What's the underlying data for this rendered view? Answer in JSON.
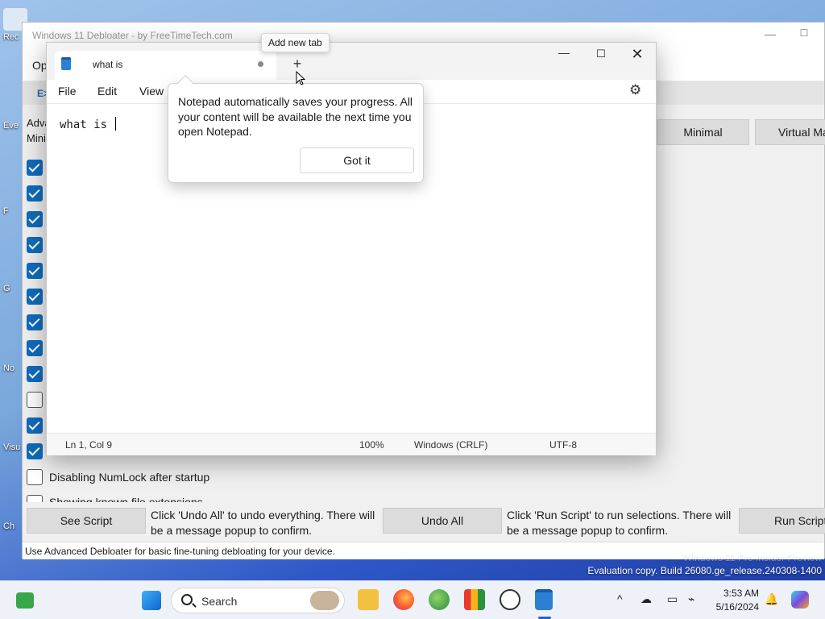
{
  "desktop": {
    "icons": [
      "Rec",
      "Eve",
      "F",
      "G",
      "No",
      "Visu",
      "Ch"
    ]
  },
  "debloater": {
    "title": "Windows 11 Debloater - by FreeTimeTech.com",
    "menu_options": "Op",
    "tab_e": "E>",
    "adv_label": "Adva",
    "mini_label": "Mini",
    "preset_minimal": "Minimal",
    "preset_virtual": "Virtual Ma",
    "checkbox_numlock": "Disabling NumLock after startup",
    "checkbox_known_ext": "Showing known file extensions",
    "see_script": "See Script",
    "undo_note": "Click 'Undo All' to undo everything. There will be a message popup to confirm.",
    "undo_all": "Undo All",
    "run_note": "Click 'Run Script' to run selections. There will be a message popup to confirm.",
    "run_script": "Run Script",
    "status": "Use Advanced Debloater for basic fine-tuning debloating for your device."
  },
  "notepad": {
    "tab_title": "what is",
    "tooltip": "Add new tab",
    "menu": {
      "file": "File",
      "edit": "Edit",
      "view": "View"
    },
    "content": "what is ",
    "tip_text": "Notepad automatically saves your progress. All your content will be available the next time you open Notepad.",
    "tip_button": "Got it",
    "status": {
      "position": "Ln 1, Col 9",
      "zoom": "100%",
      "eol": "Windows (CRLF)",
      "encoding": "UTF-8"
    }
  },
  "watermark": {
    "line1": "Windows 11 Pro Insider Preview",
    "line2": "Evaluation copy. Build 26080.ge_release.240308-1400"
  },
  "taskbar": {
    "search": "Search",
    "time": "3:53 AM",
    "date": "5/16/2024"
  }
}
